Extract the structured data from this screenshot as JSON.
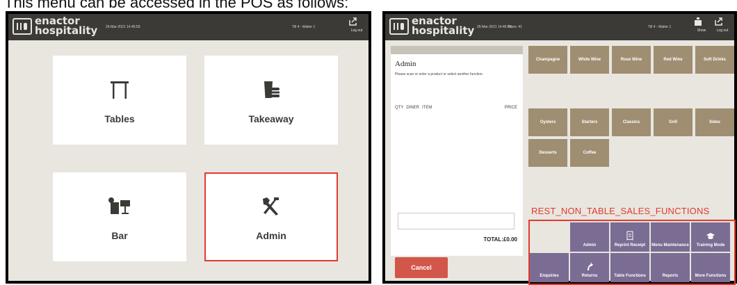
{
  "caption": "This menu can be accessed in the POS as follows:",
  "colors": {
    "topbar": "#3b3a37",
    "background": "#e8e6df",
    "highlight": "#e3392f",
    "product_button": "#a08e72",
    "function_button": "#7a6c93",
    "cancel": "#d2574a"
  },
  "screen1": {
    "logo": {
      "line1": "enactor",
      "line2": "hospitality"
    },
    "datetime": "26-Mar-2021 14:45:59",
    "till": "Till 4 - Waiter 1",
    "logout_label": "Log out",
    "tiles": [
      {
        "label": "Tables",
        "icon": "table-icon"
      },
      {
        "label": "Takeaway",
        "icon": "takeaway-cup-icon"
      },
      {
        "label": "Bar",
        "icon": "cocktail-icon"
      },
      {
        "label": "Admin",
        "icon": "tools-icon"
      }
    ]
  },
  "screen2": {
    "logo": {
      "line1": "enactor",
      "line2": "hospitality"
    },
    "datetime": "26-Mar-2021 14:46:02",
    "trans": "Trans: 41",
    "till": "Till 4 - Waiter 1",
    "show_label": "Show",
    "logout_label": "Log out",
    "panel": {
      "title": "Admin",
      "message": "Please scan or enter a product or select another function.",
      "col_qty": "QTY",
      "col_diner": "DINER",
      "col_item": "ITEM",
      "col_price": "PRICE",
      "total": "TOTAL:£0.00",
      "cancel_label": "Cancel"
    },
    "products_row1": [
      "Champagne",
      "White Wine",
      "Rose Wine",
      "Red Wine",
      "Soft Drinks"
    ],
    "products_row2": [
      "Oysters",
      "Starters",
      "Classics",
      "Grill",
      "Sides"
    ],
    "products_row3": [
      "Desserts",
      "Coffee"
    ],
    "functions_heading": "REST_NON_TABLE_SALES_FUNCTIONS",
    "functions_row1": [
      {
        "label": "",
        "icon": ""
      },
      {
        "label": "Admin",
        "icon": ""
      },
      {
        "label": "Reprint Receipt",
        "icon": "receipt-icon"
      },
      {
        "label": "Menu Maintenance",
        "icon": ""
      },
      {
        "label": "Training Mode",
        "icon": "graduation-cap-icon"
      }
    ],
    "functions_row2": [
      {
        "label": "Enquiries",
        "icon": ""
      },
      {
        "label": "Returns",
        "icon": "return-arrow-icon"
      },
      {
        "label": "Table Functions",
        "icon": ""
      },
      {
        "label": "Reports",
        "icon": ""
      },
      {
        "label": "More Functions",
        "icon": ""
      }
    ]
  }
}
